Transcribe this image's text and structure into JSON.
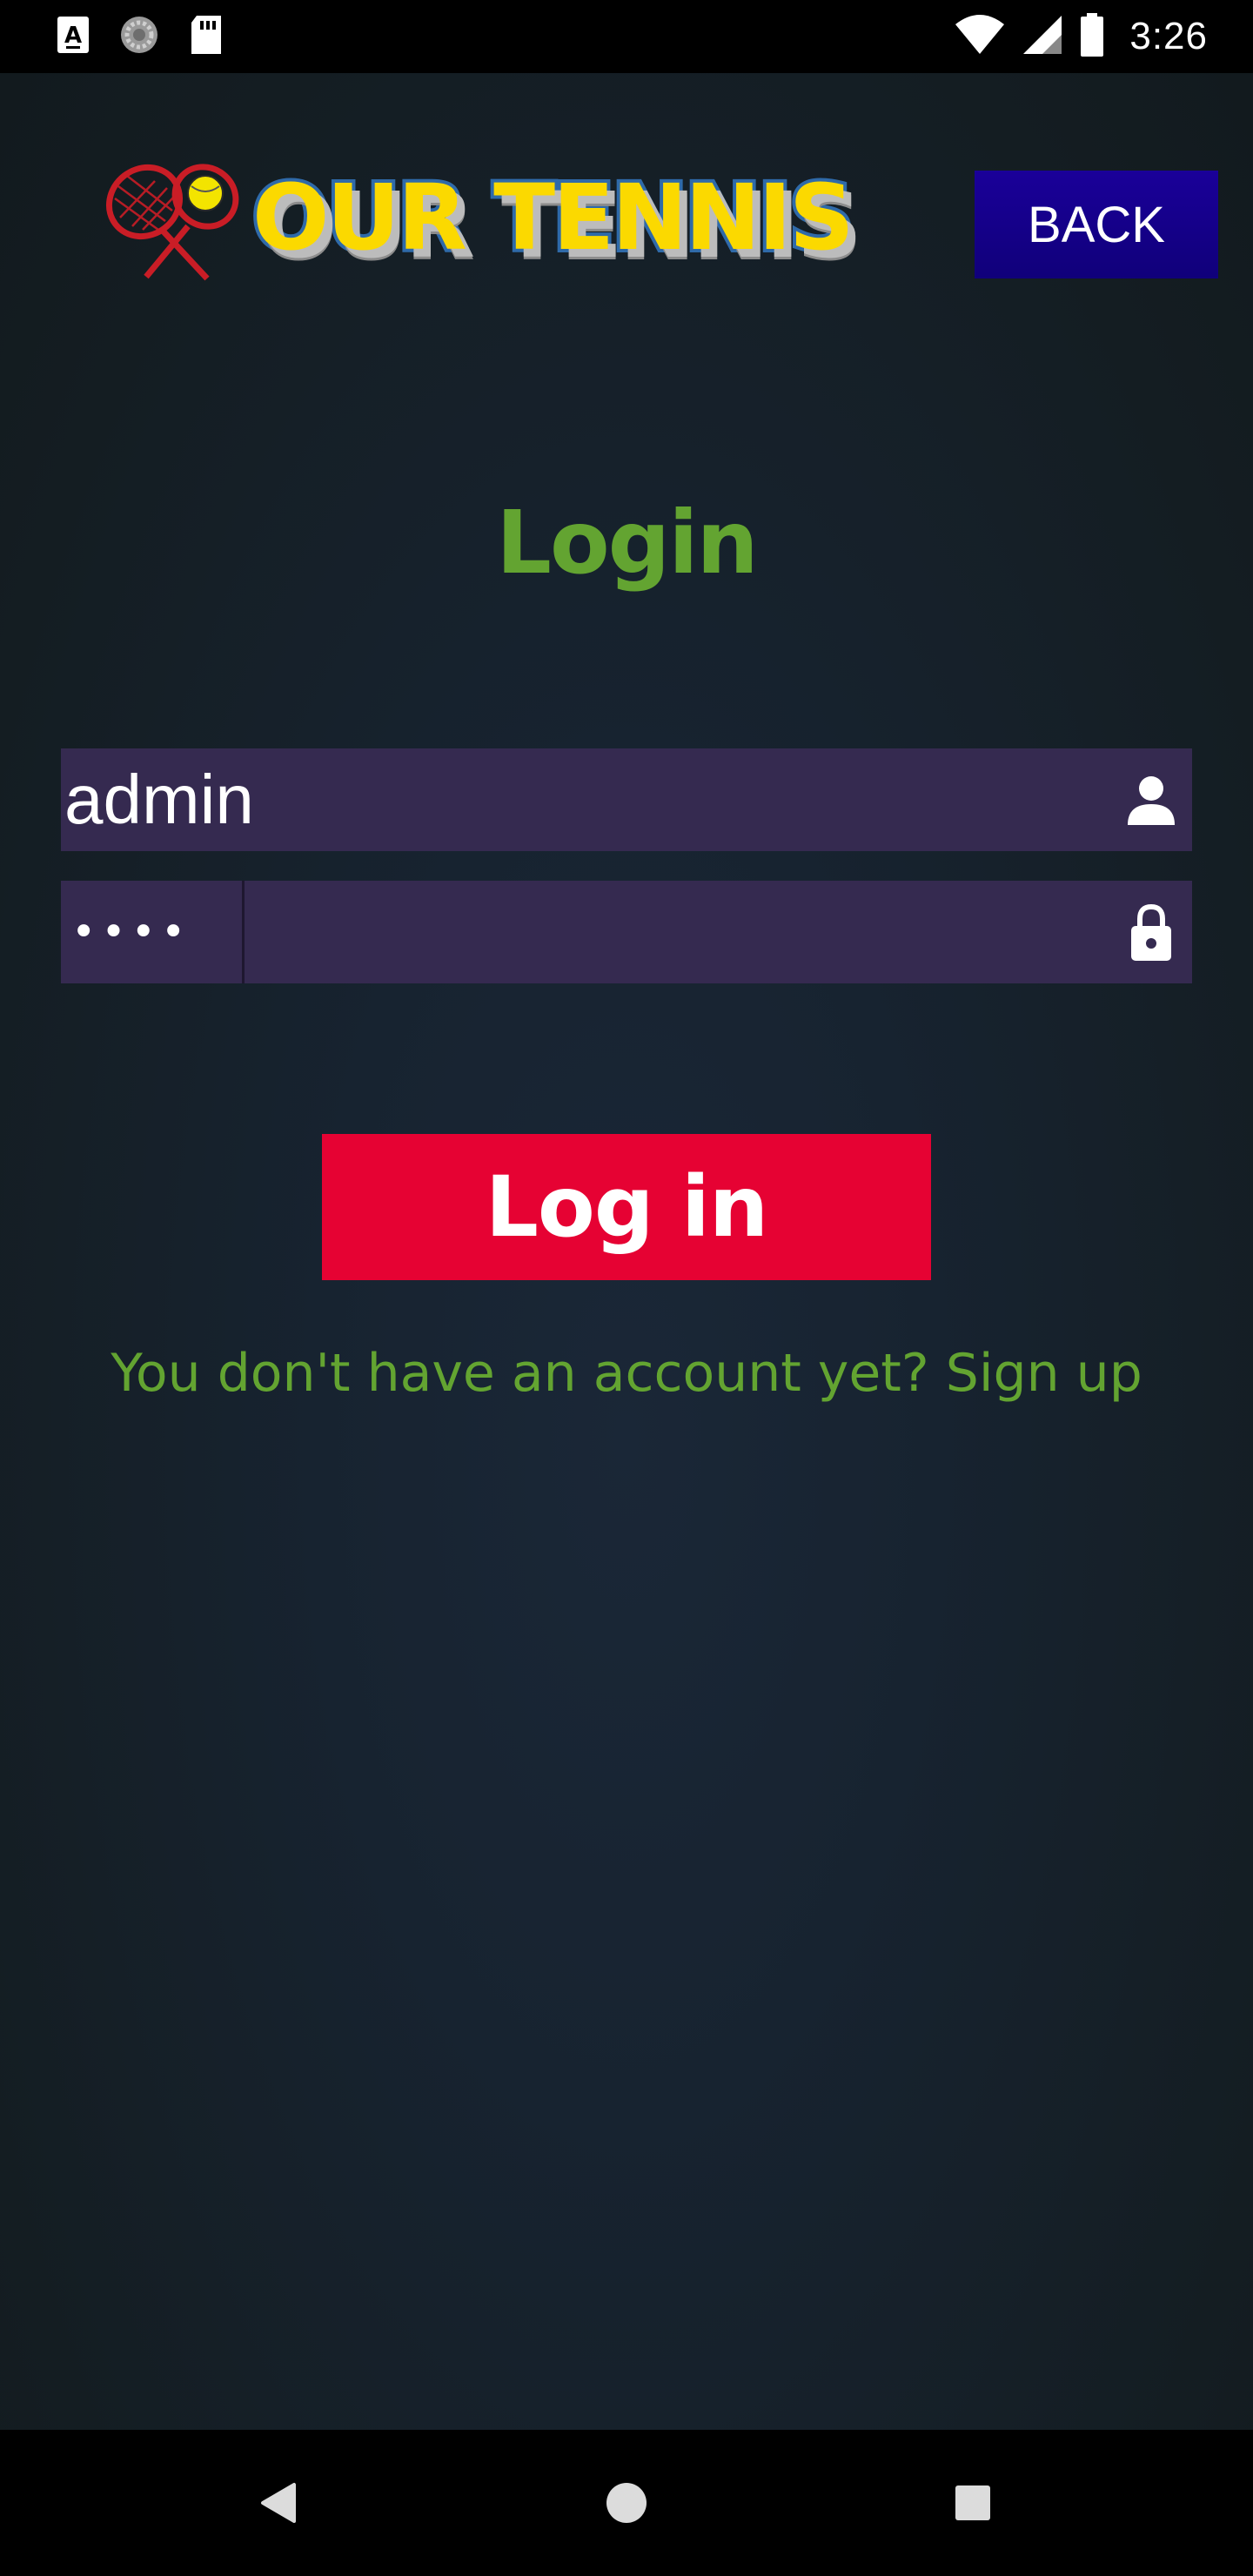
{
  "status_bar": {
    "time": "3:26",
    "left_icons": [
      "font-a-icon",
      "loading-circle-icon",
      "sd-card-icon"
    ],
    "right_icons": [
      "wifi-icon",
      "signal-icon",
      "battery-icon"
    ]
  },
  "header": {
    "logo_text": "OUR TENNIS",
    "back_label": "BACK"
  },
  "login": {
    "title": "Login",
    "username": {
      "value": "admin",
      "icon": "person-icon"
    },
    "password": {
      "masked_value": "••••",
      "icon": "lock-icon"
    },
    "submit_label": "Log in",
    "signup_text": "You don't have an account yet? Sign up"
  },
  "nav_bar": {
    "icons": [
      "back-triangle-icon",
      "home-circle-icon",
      "recents-square-icon"
    ]
  },
  "colors": {
    "accent_green": "#63a431",
    "button_red": "#e60233",
    "back_button_blue": "#1a0099",
    "field_purple": "#352a50",
    "logo_yellow": "#fbd900",
    "logo_blue": "#2f6aa9"
  }
}
